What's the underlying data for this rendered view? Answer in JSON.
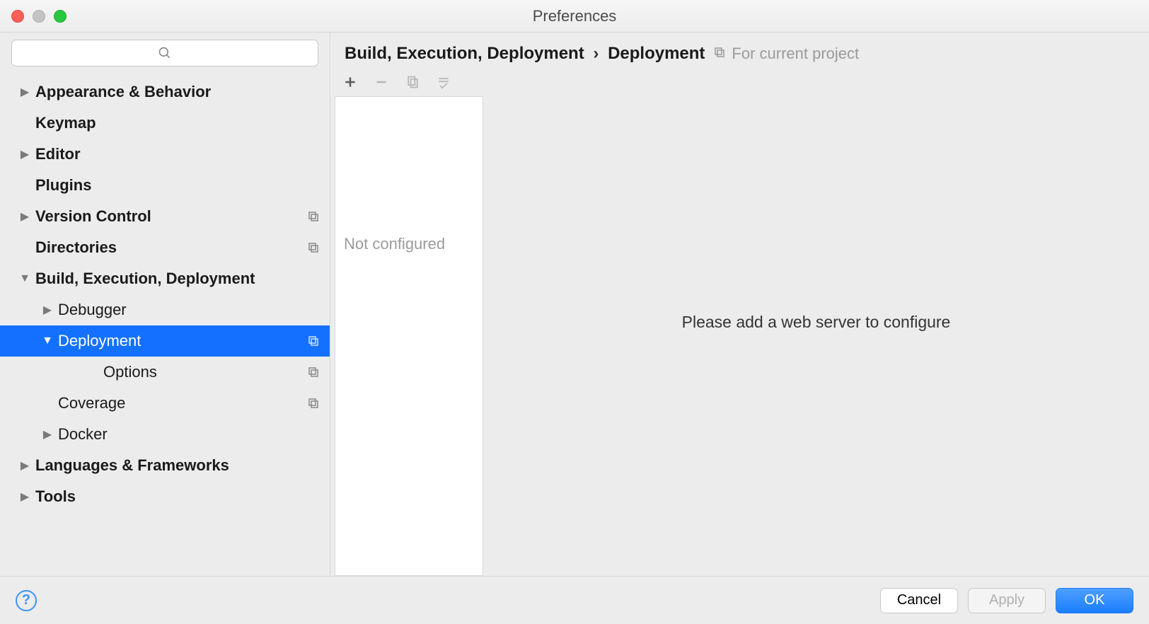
{
  "window": {
    "title": "Preferences"
  },
  "search": {
    "placeholder": ""
  },
  "sidebar": {
    "items": [
      {
        "label": "Appearance & Behavior"
      },
      {
        "label": "Keymap"
      },
      {
        "label": "Editor"
      },
      {
        "label": "Plugins"
      },
      {
        "label": "Version Control"
      },
      {
        "label": "Directories"
      },
      {
        "label": "Build, Execution, Deployment"
      },
      {
        "label": "Debugger"
      },
      {
        "label": "Deployment"
      },
      {
        "label": "Options"
      },
      {
        "label": "Coverage"
      },
      {
        "label": "Docker"
      },
      {
        "label": "Languages & Frameworks"
      },
      {
        "label": "Tools"
      }
    ]
  },
  "breadcrumb": {
    "part1": "Build, Execution, Deployment",
    "sep": "›",
    "part2": "Deployment",
    "for_project": "For current project"
  },
  "list": {
    "empty": "Not configured"
  },
  "detail": {
    "empty": "Please add a web server to configure"
  },
  "footer": {
    "cancel": "Cancel",
    "apply": "Apply",
    "ok": "OK"
  }
}
